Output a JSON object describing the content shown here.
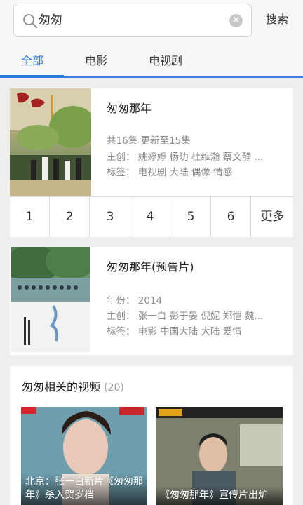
{
  "search": {
    "query": "匆匆",
    "button_label": "搜索"
  },
  "tabs": [
    {
      "label": "全部",
      "active": true
    },
    {
      "label": "电影",
      "active": false
    },
    {
      "label": "电视剧",
      "active": false
    }
  ],
  "results": [
    {
      "title": "匆匆那年",
      "lines": [
        "共16集 更新至15集",
        "主创： 姚婷婷  杨玏  杜维瀚  蔡文静  ...",
        "标签： 电视剧 大陆 偶像 情感"
      ],
      "episodes": [
        "1",
        "2",
        "3",
        "4",
        "5",
        "6",
        "更多"
      ]
    },
    {
      "title": "匆匆那年(预告片)",
      "lines": [
        "年份： 2014",
        "主创： 张一白  彭于晏  倪妮  郑恺  魏...",
        "标签： 电影 中国大陆 大陆 爱情"
      ]
    }
  ],
  "related": {
    "title": "匆匆相关的视频",
    "count": "(20)",
    "videos": [
      {
        "caption": "北京：张一白新片《匆匆那年》杀入贺岁档"
      },
      {
        "caption": "《匆匆那年》宣传片出炉"
      }
    ]
  },
  "colors": {
    "accent": "#2f7de1",
    "background": "#eeeeee"
  }
}
